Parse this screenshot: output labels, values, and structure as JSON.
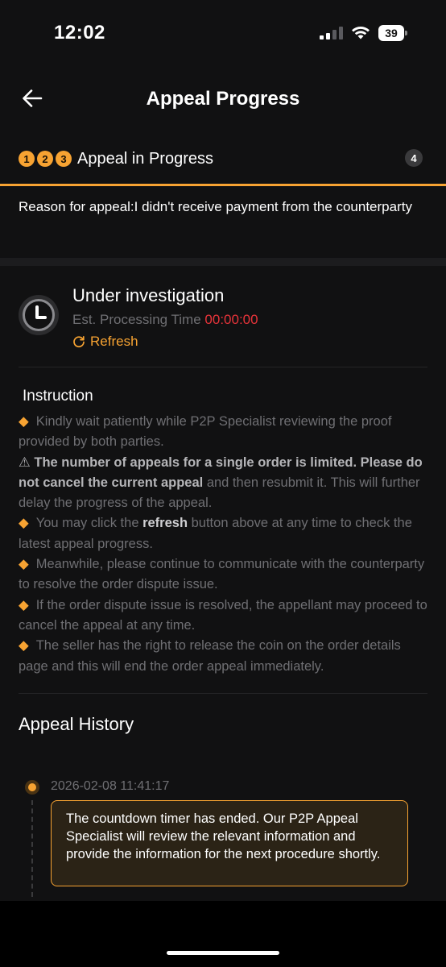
{
  "status_bar": {
    "time": "12:02",
    "battery": "39"
  },
  "header": {
    "title": "Appeal Progress"
  },
  "steps": {
    "done": [
      "1",
      "2",
      "3"
    ],
    "current_label": "Appeal in Progress",
    "next": "4"
  },
  "reason": "Reason for appeal:I didn't receive payment from the counterparty",
  "investigation": {
    "title": "Under investigation",
    "est_label": "Est. Processing Time",
    "est_time": "00:00:00",
    "refresh_label": "Refresh"
  },
  "instruction": {
    "title": "Instruction",
    "item1": "Kindly wait patiently while P2P Specialist reviewing the proof provided by both parties.",
    "item2_bold": "The number of appeals for a single order is limited. Please do not cancel the current appeal",
    "item2_rest": " and then resubmit it. This will further delay the progress of the appeal.",
    "item3_pre": "You may click the ",
    "item3_bold": "refresh",
    "item3_post": " button above at any time to check the latest appeal progress.",
    "item4": "Meanwhile, please continue to communicate with the counterparty to resolve the order dispute issue.",
    "item5": "If the order dispute issue is resolved, the appellant may proceed to cancel the appeal at any time.",
    "item6": "The seller has the right to release the coin on the order details page and this will end the order appeal immediately."
  },
  "history": {
    "title": "Appeal History",
    "entries": [
      {
        "date": "2026-02-08 11:41:17",
        "message": "The countdown timer has ended. Our P2P Appeal Specialist will review the relevant information and provide the information for the next procedure shortly."
      }
    ]
  },
  "colors": {
    "accent": "#f7a332",
    "danger": "#e8343a",
    "background": "#111112",
    "muted": "#6f6f73"
  }
}
